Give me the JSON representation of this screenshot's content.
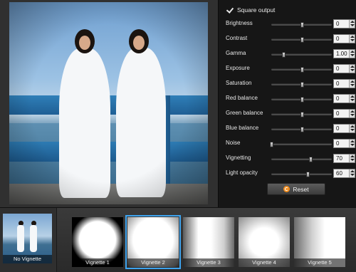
{
  "options": {
    "square_output_label": "Square output",
    "square_output_checked": true
  },
  "controls": [
    {
      "label": "Brightness",
      "value": "0",
      "level": 0.5
    },
    {
      "label": "Contrast",
      "value": "0",
      "level": 0.5
    },
    {
      "label": "Gamma",
      "value": "1.00",
      "level": 0.2
    },
    {
      "label": "Exposure",
      "value": "0",
      "level": 0.5
    },
    {
      "label": "Saturation",
      "value": "0",
      "level": 0.5
    },
    {
      "label": "Red balance",
      "value": "0",
      "level": 0.5
    },
    {
      "label": "Green balance",
      "value": "0",
      "level": 0.5
    },
    {
      "label": "Blue balance",
      "value": "0",
      "level": 0.5
    },
    {
      "label": "Noise",
      "value": "0",
      "level": 0.0
    },
    {
      "label": "Vignetting",
      "value": "70",
      "level": 0.65
    },
    {
      "label": "Light opacity",
      "value": "60",
      "level": 0.6
    }
  ],
  "reset": {
    "label": "Reset",
    "icon": "reset-icon"
  },
  "source": {
    "label": "No Vignette"
  },
  "vignettes": [
    {
      "label": "Vignette 1",
      "style": "circle-hard",
      "selected": false
    },
    {
      "label": "Vignette 2",
      "style": "soft-square",
      "selected": true
    },
    {
      "label": "Vignette 3",
      "style": "vertical-soft",
      "selected": false
    },
    {
      "label": "Vignette 4",
      "style": "radial-soft",
      "selected": false
    },
    {
      "label": "Vignette 5",
      "style": "horizontal-fade",
      "selected": false
    }
  ],
  "colors": {
    "accent_selected": "#3ea3ee",
    "reset_icon": "#f08c1e"
  }
}
